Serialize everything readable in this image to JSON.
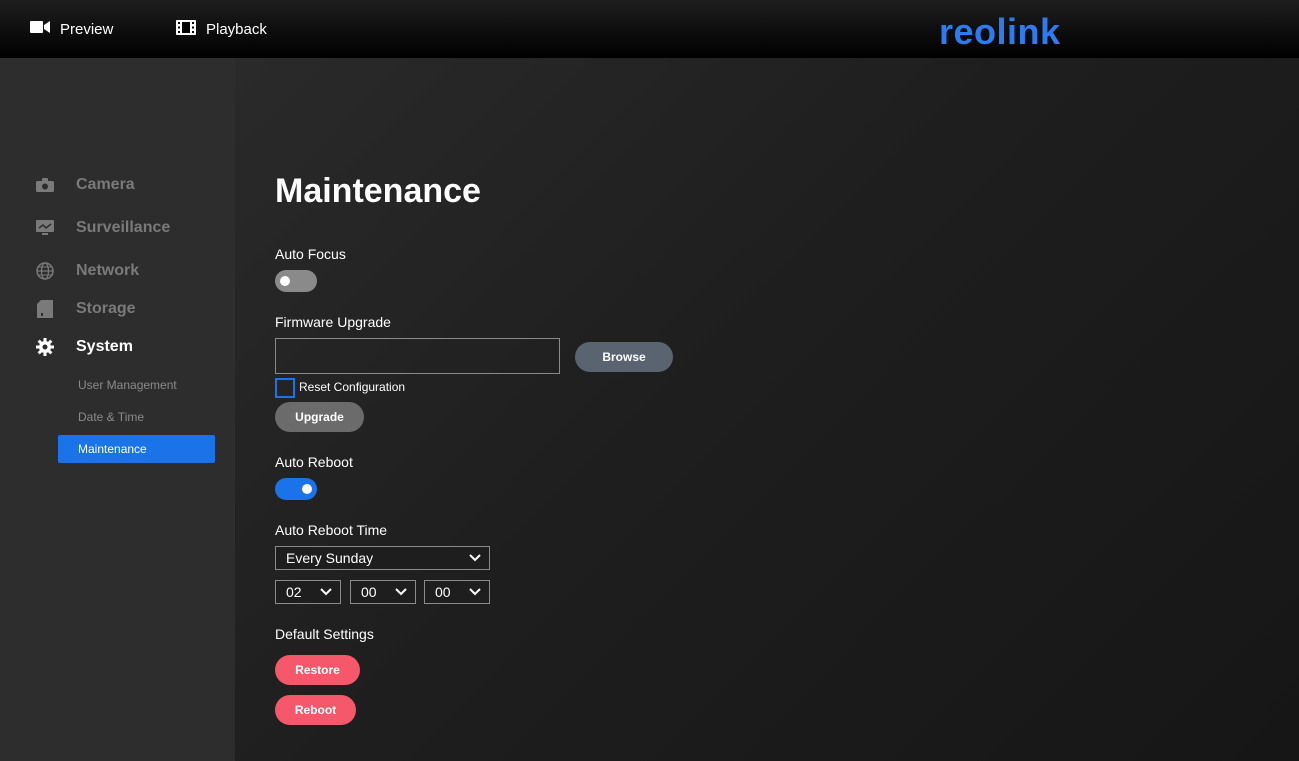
{
  "topbar": {
    "preview_label": "Preview",
    "playback_label": "Playback",
    "logo_text": "reolink",
    "logo_color": "#2a7cf0"
  },
  "sidebar": {
    "items": [
      {
        "label": "Camera",
        "icon": "camera-icon"
      },
      {
        "label": "Surveillance",
        "icon": "monitor-icon"
      },
      {
        "label": "Network",
        "icon": "globe-icon"
      },
      {
        "label": "Storage",
        "icon": "sd-card-icon"
      },
      {
        "label": "System",
        "icon": "gear-icon",
        "active": true
      }
    ],
    "sub_items": [
      {
        "label": "User Management"
      },
      {
        "label": "Date & Time"
      },
      {
        "label": "Maintenance",
        "active": true
      }
    ]
  },
  "main": {
    "title": "Maintenance",
    "auto_focus": {
      "label": "Auto Focus",
      "enabled": false
    },
    "firmware": {
      "label": "Firmware Upgrade",
      "file_value": "",
      "browse_label": "Browse",
      "reset_config_label": "Reset Configuration",
      "reset_config_checked": false,
      "upgrade_label": "Upgrade"
    },
    "auto_reboot": {
      "label": "Auto Reboot",
      "enabled": true
    },
    "auto_reboot_time": {
      "label": "Auto Reboot Time",
      "day": "Every Sunday",
      "hour": "02",
      "minute": "00",
      "second": "00"
    },
    "default_settings": {
      "label": "Default Settings",
      "restore_label": "Restore",
      "reboot_label": "Reboot"
    }
  },
  "colors": {
    "accent": "#1a73e8",
    "danger": "#f4586a",
    "browse": "#5a6370"
  }
}
